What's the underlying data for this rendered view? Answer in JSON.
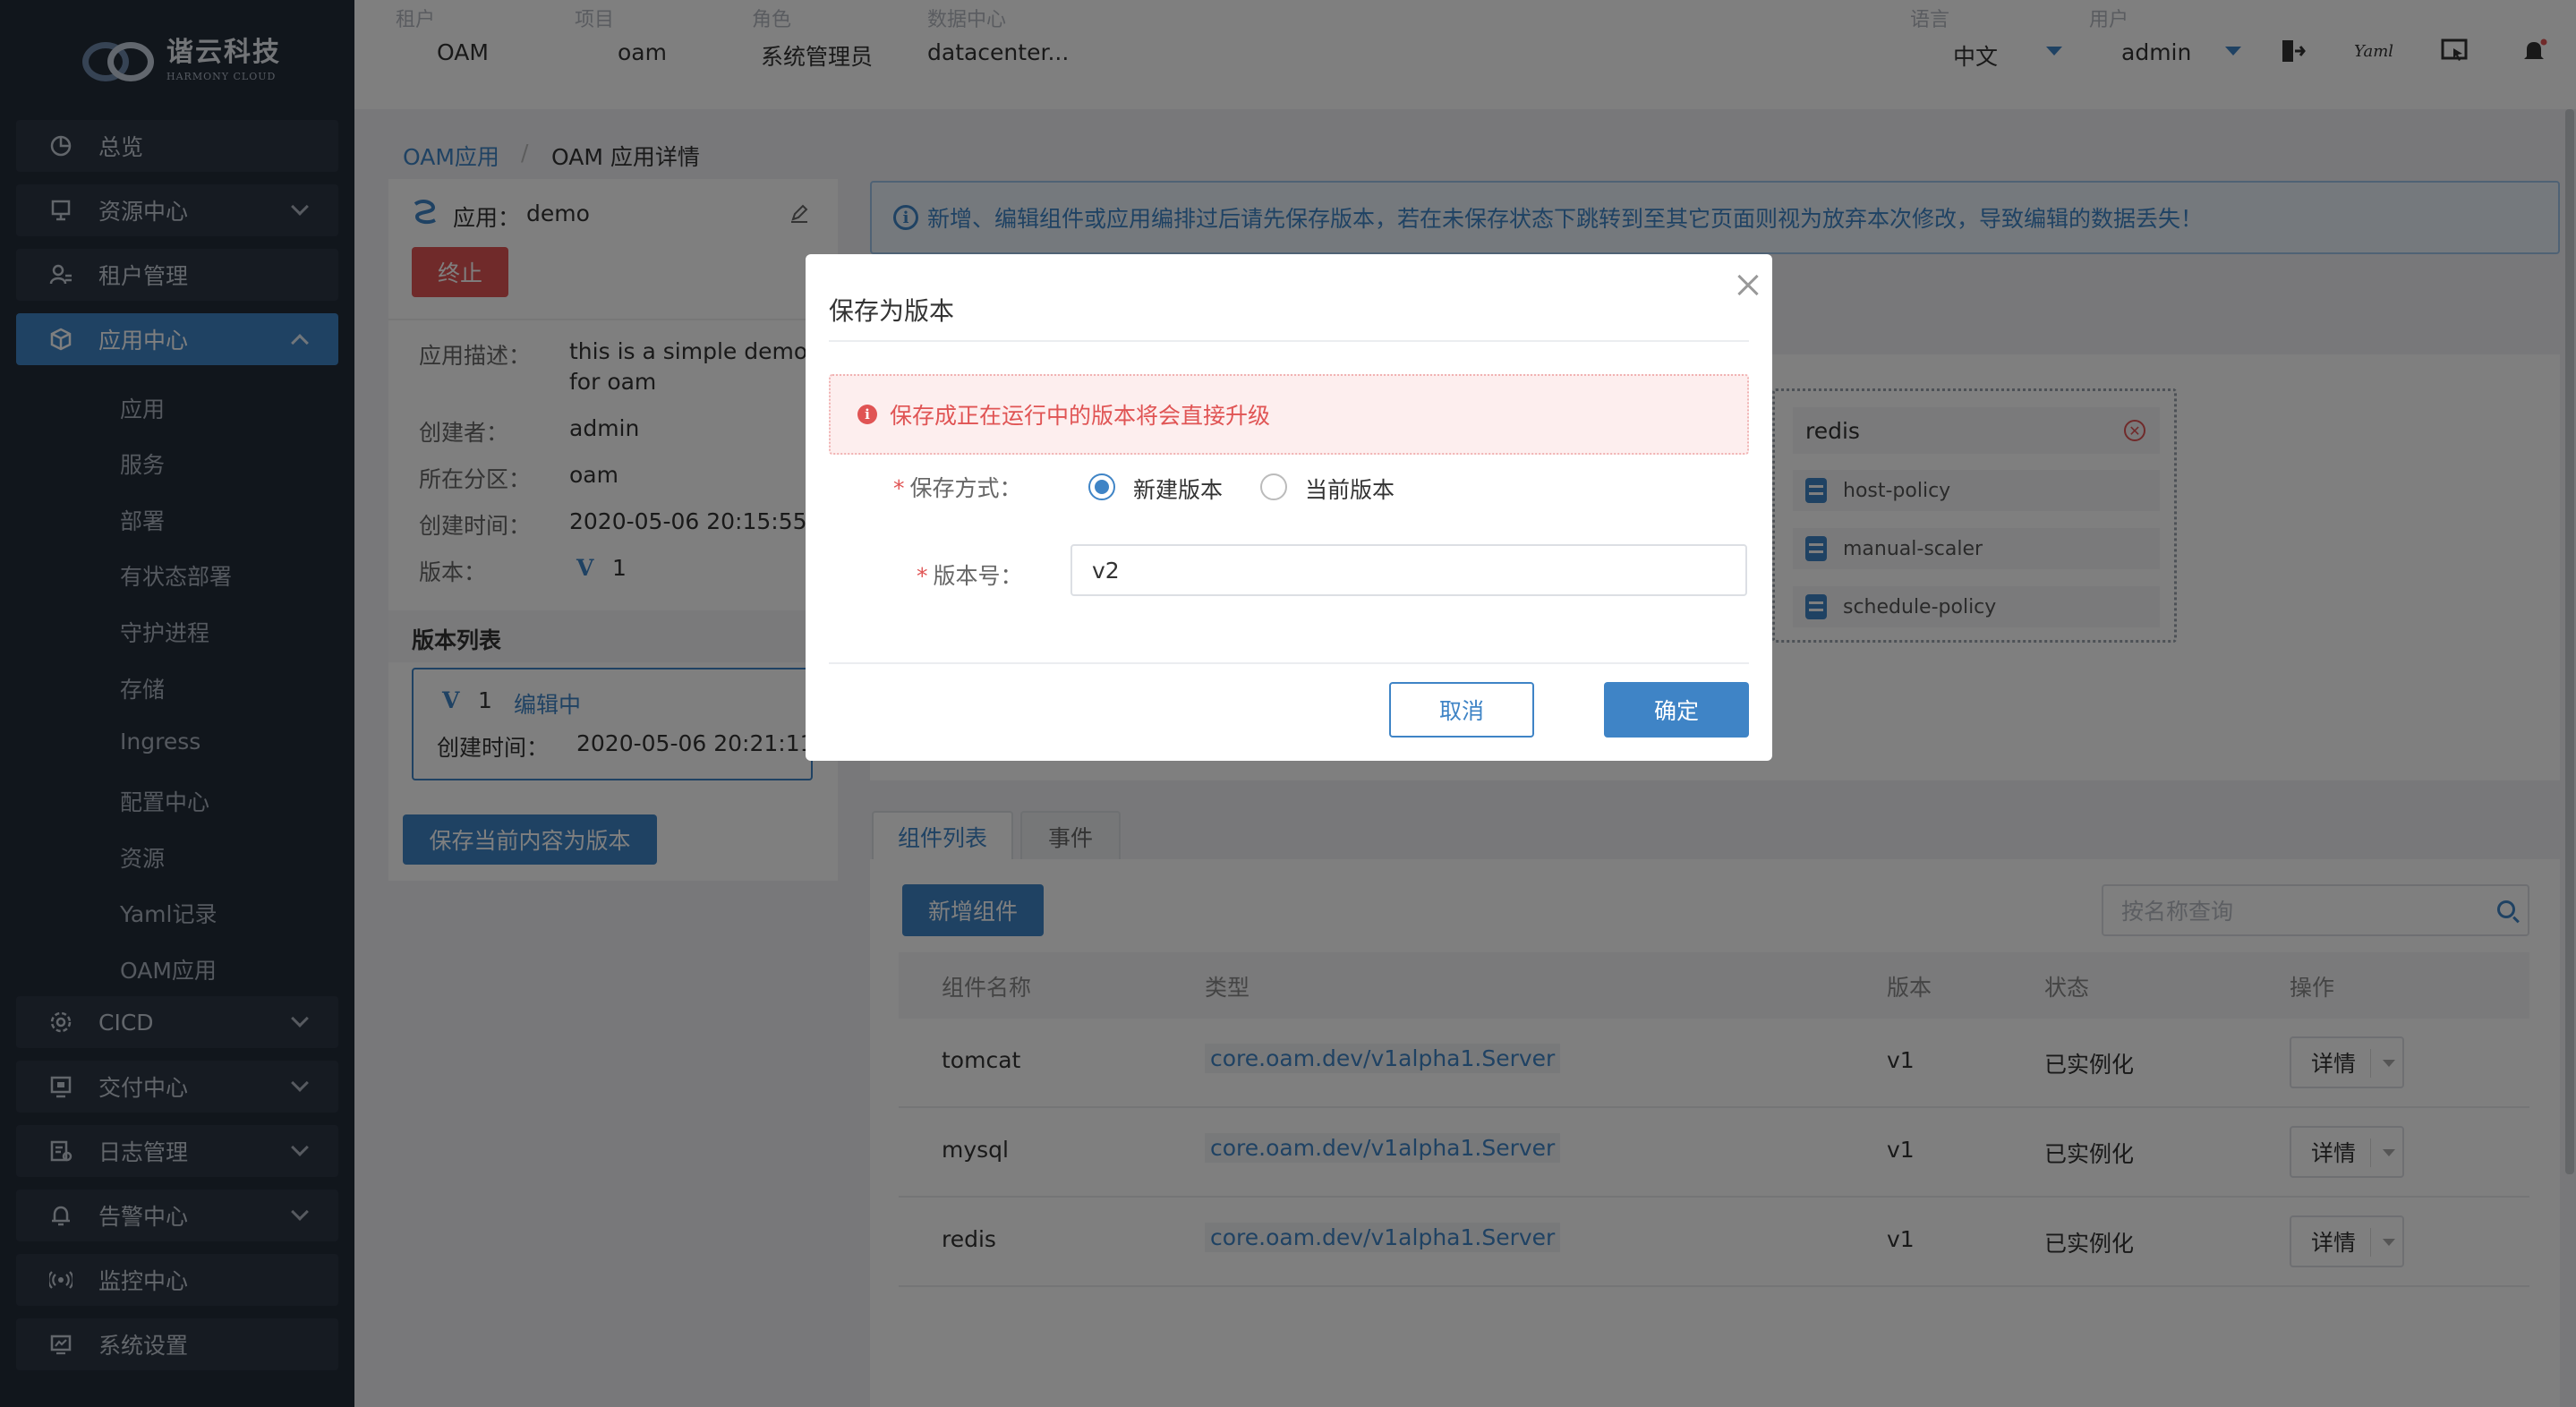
{
  "brand": {
    "name_cn": "谐云科技",
    "name_en": "HARMONY CLOUD"
  },
  "topbar": {
    "tenant_label": "租户",
    "tenant_value": "OAM",
    "project_label": "项目",
    "project_value": "oam",
    "role_label": "角色",
    "role_value": "系统管理员",
    "dc_label": "数据中心",
    "dc_value": "datacenter...",
    "lang_label": "语言",
    "lang_value": "中文",
    "user_label": "用户",
    "user_value": "admin",
    "yaml_icon_text": "Yaml"
  },
  "sidebar": {
    "items": [
      {
        "label": "总览",
        "icon": "pie-chart-icon"
      },
      {
        "label": "资源中心",
        "icon": "monitor-icon"
      },
      {
        "label": "租户管理",
        "icon": "users-icon"
      },
      {
        "label": "应用中心",
        "icon": "box-icon"
      },
      {
        "label": "CICD",
        "icon": "cicd-icon"
      },
      {
        "label": "交付中心",
        "icon": "delivery-icon"
      },
      {
        "label": "日志管理",
        "icon": "log-icon"
      },
      {
        "label": "告警中心",
        "icon": "bell-icon"
      },
      {
        "label": "监控中心",
        "icon": "signal-icon"
      },
      {
        "label": "系统设置",
        "icon": "settings-icon"
      }
    ],
    "sub_items": [
      "应用",
      "服务",
      "部署",
      "有状态部署",
      "守护进程",
      "存储",
      "Ingress",
      "配置中心",
      "资源",
      "Yaml记录",
      "OAM应用"
    ]
  },
  "breadcrumb": {
    "parent": "OAM应用",
    "separator": "/",
    "current": "OAM 应用详情"
  },
  "app_panel": {
    "app_label": "应用：",
    "app_name": "demo",
    "terminate_button": "终止",
    "desc_label": "应用描述：",
    "desc_value_line1": "this is a simple demo",
    "desc_value_line2": "for oam",
    "creator_label": "创建者：",
    "creator_value": "admin",
    "partition_label": "所在分区：",
    "partition_value": "oam",
    "created_label": "创建时间：",
    "created_value": "2020-05-06 20:15:55",
    "version_label": "版本：",
    "version_badge": "V",
    "version_value": "1",
    "version_list_title": "版本列表",
    "version_card": {
      "badge": "V",
      "number": "1",
      "status": "编辑中",
      "created_label": "创建时间：",
      "created_value": "2020-05-06 20:21:11"
    },
    "save_version_button": "保存当前内容为版本"
  },
  "info_banner": "新增、编辑组件或应用编排过后请先保存版本，若在未保存状态下跳转到至其它页面则视为放弃本次修改，导致编辑的数据丢失！",
  "topology": {
    "component": "redis",
    "traits": [
      "host-policy",
      "manual-scaler",
      "schedule-policy"
    ]
  },
  "tabs": [
    "组件列表",
    "事件"
  ],
  "components_toolbar": {
    "add_button": "新增组件",
    "search_placeholder": "按名称查询"
  },
  "table": {
    "columns": [
      "组件名称",
      "类型",
      "版本",
      "状态",
      "操作"
    ],
    "rows": [
      {
        "name": "tomcat",
        "type": "core.oam.dev/v1alpha1.Server",
        "version": "v1",
        "status": "已实例化",
        "action": "详情"
      },
      {
        "name": "mysql",
        "type": "core.oam.dev/v1alpha1.Server",
        "version": "v1",
        "status": "已实例化",
        "action": "详情"
      },
      {
        "name": "redis",
        "type": "core.oam.dev/v1alpha1.Server",
        "version": "v1",
        "status": "已实例化",
        "action": "详情"
      }
    ]
  },
  "modal": {
    "title": "保存为版本",
    "warning": "保存成正在运行中的版本将会直接升级",
    "required_mark": "*",
    "mode_label": "保存方式：",
    "mode_options": [
      "新建版本",
      "当前版本"
    ],
    "mode_selected": "新建版本",
    "version_label": "版本号：",
    "version_value": "v2",
    "cancel_button": "取消",
    "confirm_button": "确定"
  },
  "colors": {
    "accent": "#3f84c6",
    "danger": "#e05454",
    "sidebar_bg": "#232c39"
  }
}
